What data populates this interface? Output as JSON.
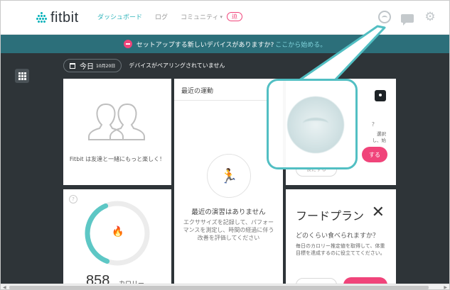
{
  "header": {
    "logo_text": "fitbit",
    "nav": [
      {
        "label": "ダッシュボード",
        "active": true
      },
      {
        "label": "ログ",
        "active": false
      },
      {
        "label": "コミュニティ",
        "active": false
      }
    ],
    "community_caret": "▾",
    "badge": "迫"
  },
  "banner": {
    "text": "セットアップする新しいデバイスがありますか?",
    "link": "ここから始める。"
  },
  "datebar": {
    "today": "今日",
    "date": "10月20日",
    "pairing_status": "デバイスがペアリングされていません"
  },
  "friends_card": {
    "text": "Fitbit は友達と一緒にもっと楽しく！"
  },
  "activity_card": {
    "title": "最近の運動",
    "empty": "最近の演習はありません",
    "description": "エクササイズを記録して、パフォーマンスを測定し、時間の経過に伴う改善を評価してください"
  },
  "device_card": {
    "question": "?",
    "small_text": "選択 し、始",
    "setup_label": "する",
    "later_label": "後にする"
  },
  "calories_card": {
    "help": "?",
    "progress": 0.38,
    "value": "858",
    "unit": "カロリー"
  },
  "food_card": {
    "title": "フードプラン",
    "question": "どのくらい食べられますか？",
    "description": "毎日のカロリー推定値を取得して、体重目標を達成するのに役立ててください。"
  },
  "colors": {
    "accent": "#2fb4bb",
    "banner": "#2c6f7a",
    "pink": "#f0447a",
    "dark_bg": "#2e3438",
    "callout_border": "#52bfc3"
  },
  "icons": [
    "fitbit-logo-icon",
    "profile-icon",
    "chat-icon",
    "gear-icon",
    "grid-icon",
    "calendar-icon",
    "friends-icon",
    "run-icon",
    "device-icon",
    "flame-icon",
    "fork-knife-icon",
    "zoom-profile-icon"
  ]
}
